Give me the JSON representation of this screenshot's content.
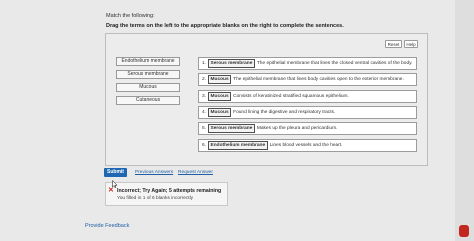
{
  "instructions": {
    "line1": "Match the following:",
    "line2": "Drag the terms on the left to the appropriate blanks on the right to complete the sentences."
  },
  "toolbar": {
    "reset_label": "Reset",
    "help_label": "Help"
  },
  "terms": [
    "Endothelium membrane",
    "Serous membrane",
    "Mucous",
    "Cutaneous"
  ],
  "sentences": [
    {
      "number": "1.",
      "term": "Serous membrane",
      "text": "The epithelial membrane that lines the closed ventral cavities of the body."
    },
    {
      "number": "2.",
      "term": "Mucous",
      "text": "The epithelial membrane that lines body cavities open to the exterior membrane."
    },
    {
      "number": "3.",
      "term": "Mucous",
      "text": "Consists of keratinized stratified squamous epithelium."
    },
    {
      "number": "4.",
      "term": "Mucous",
      "text": "Found lining the digestive and respiratory tracts."
    },
    {
      "number": "5.",
      "term": "Serous membrane",
      "text": "Makes up the pleura and pericardium."
    },
    {
      "number": "6.",
      "term": "Endothelium membrane",
      "text": "Lines blood vessels and the heart."
    }
  ],
  "actions": {
    "submit_label": "Submit",
    "previous_answers_label": "Previous Answers",
    "request_answer_label": "Request Answer"
  },
  "feedback": {
    "title": "Incorrect; Try Again; 5 attempts remaining",
    "subtitle": "You filled in 1 of 6 blanks incorrectly"
  },
  "footer": {
    "provide_feedback_label": "Provide Feedback"
  },
  "colors": {
    "submit": "#1f67b3",
    "error": "#c8261e",
    "link": "#1f5fa5"
  }
}
